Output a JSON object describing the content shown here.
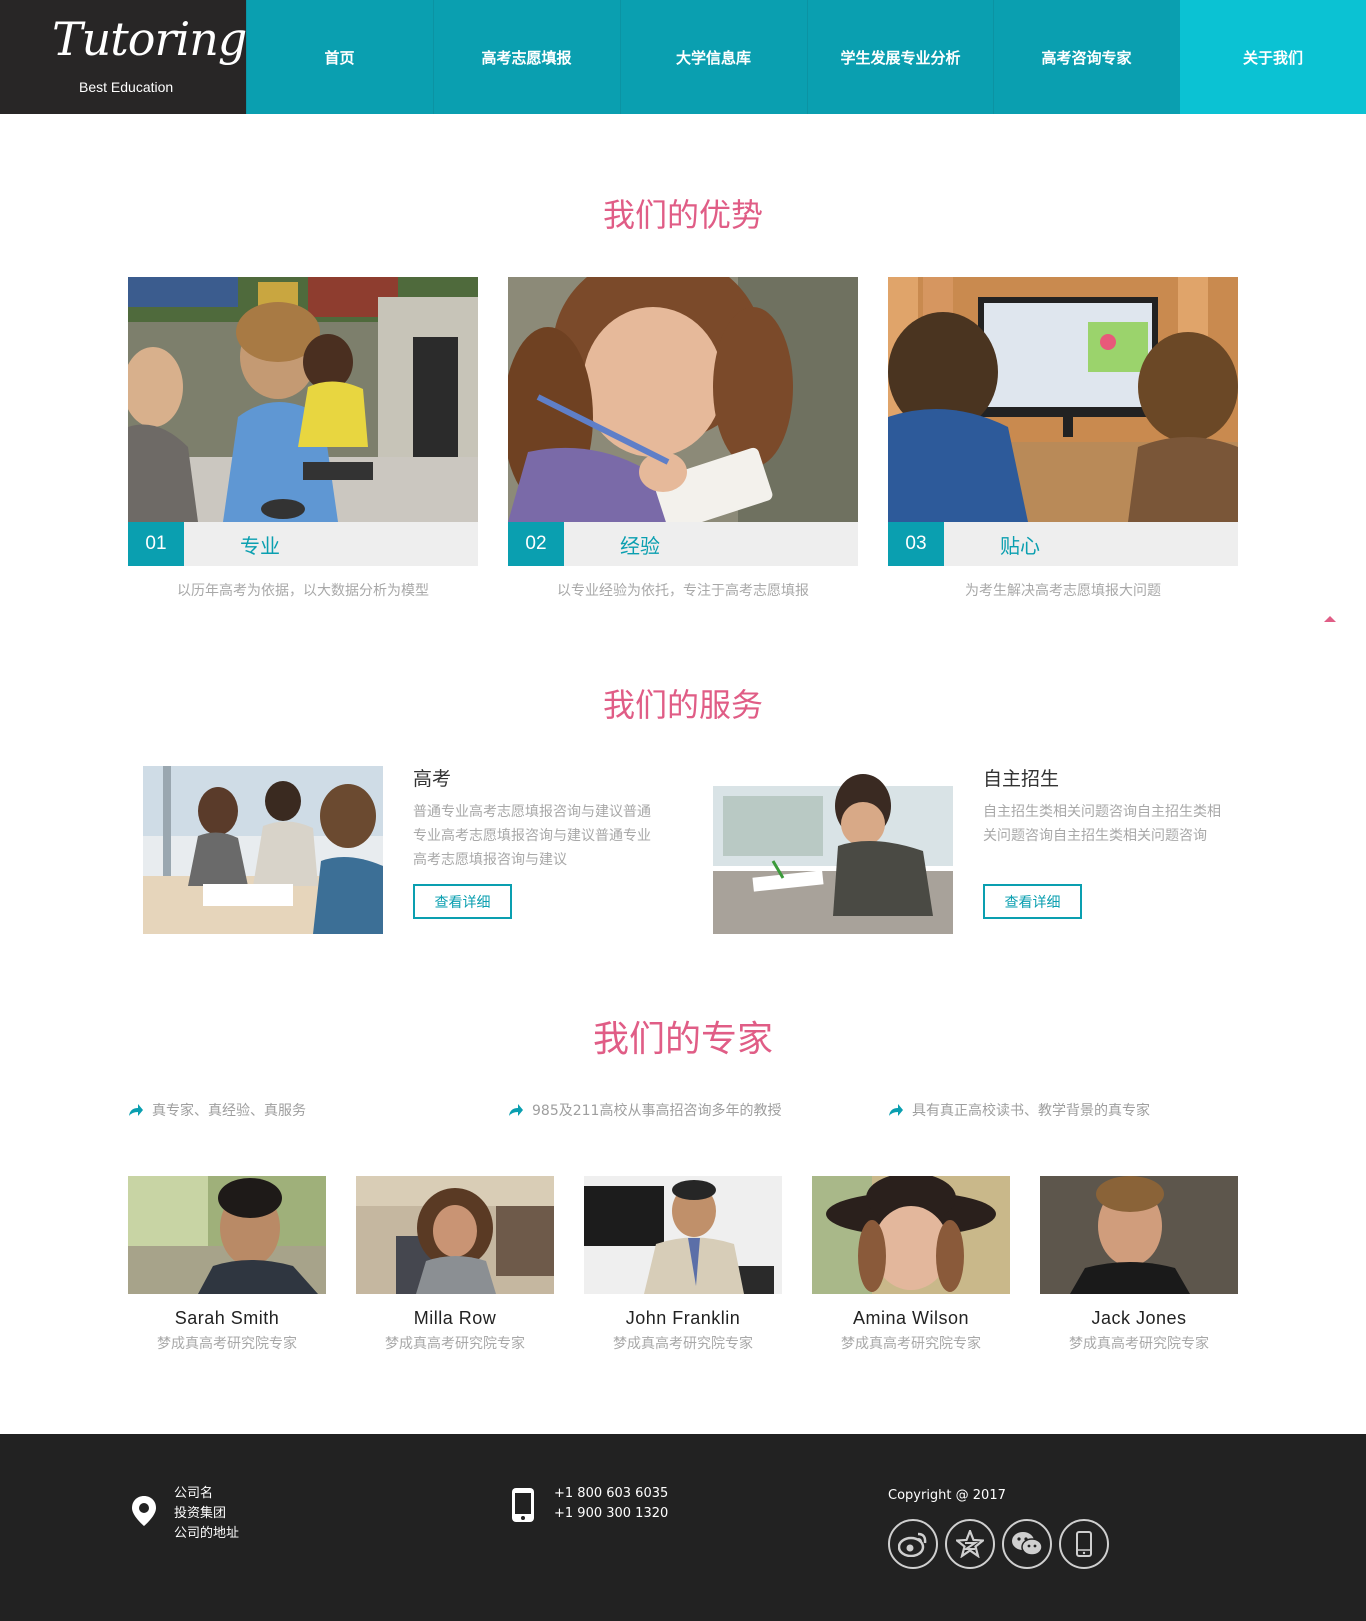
{
  "brand": {
    "logo_word": "Tutoring",
    "logo_sub": "Best Education"
  },
  "nav": {
    "items": [
      {
        "label": "首页"
      },
      {
        "label": "高考志愿填报"
      },
      {
        "label": "大学信息库"
      },
      {
        "label": "学生发展专业分析"
      },
      {
        "label": "高考咨询专家"
      },
      {
        "label": "关于我们"
      }
    ],
    "active_index": 5
  },
  "advantages": {
    "title": "我们的优势",
    "items": [
      {
        "num": "01",
        "label": "专业",
        "desc": "以历年高考为依据，以大数据分析为模型",
        "photo": "kids-at-computers"
      },
      {
        "num": "02",
        "label": "经验",
        "desc": "以专业经验为依托，专注于高考志愿填报",
        "photo": "girl-writing"
      },
      {
        "num": "03",
        "label": "贴心",
        "desc": "为考生解决高考志愿填报大问题",
        "photo": "boys-at-monitor"
      }
    ]
  },
  "services": {
    "title": "我们的服务",
    "items": [
      {
        "title": "高考",
        "desc": "普通专业高考志愿填报咨询与建议普通专业高考志愿填报咨询与建议普通专业高考志愿填报咨询与建议",
        "button": "查看详细",
        "photo": "students-at-table"
      },
      {
        "title": "自主招生",
        "desc": "自主招生类相关问题咨询自主招生类相关问题咨询自主招生类相关问题咨询",
        "button": "查看详细",
        "photo": "boy-writing"
      }
    ]
  },
  "experts": {
    "title": "我们的专家",
    "features": [
      "真专家、真经验、真服务",
      "985及211高校从事高招咨询多年的教授",
      "具有真正高校读书、教学背景的真专家"
    ],
    "people": [
      {
        "name": "Sarah Smith",
        "role": "梦成真高考研究院专家"
      },
      {
        "name": "Milla Row",
        "role": "梦成真高考研究院专家"
      },
      {
        "name": "John Franklin",
        "role": "梦成真高考研究院专家"
      },
      {
        "name": "Amina Wilson",
        "role": "梦成真高考研究院专家"
      },
      {
        "name": "Jack Jones",
        "role": "梦成真高考研究院专家"
      }
    ]
  },
  "footer": {
    "address_lines": [
      "公司名",
      "投资集团",
      "公司的地址"
    ],
    "phones": [
      "+1 800 603 6035",
      "+1 900 300 1320"
    ],
    "copyright": "Copyright @ 2017",
    "social_icons": [
      "weibo-icon",
      "qzone-star-icon",
      "wechat-icon",
      "mobile-icon"
    ]
  },
  "colors": {
    "teal": "#0a9fb0",
    "teal_active": "#0bc2d3",
    "pink": "#e05d86",
    "dark": "#282626",
    "footer": "#222222"
  }
}
